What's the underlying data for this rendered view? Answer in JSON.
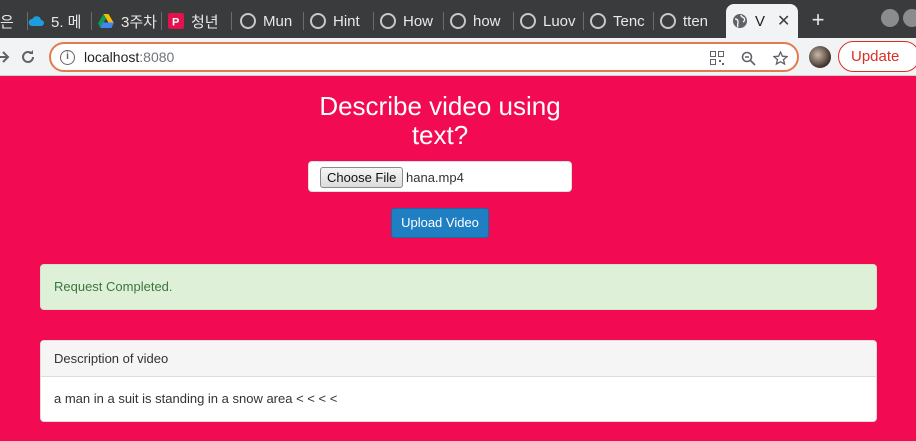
{
  "browser": {
    "tabs": [
      {
        "label": "은",
        "icon": "generic-icon"
      },
      {
        "label": "5. 메",
        "icon": "cloud-icon"
      },
      {
        "label": "3주차",
        "icon": "drive-icon"
      },
      {
        "label": "청년",
        "icon": "p-logo-icon"
      },
      {
        "label": "Mun",
        "icon": "github-icon"
      },
      {
        "label": "Hint",
        "icon": "github-icon"
      },
      {
        "label": "How",
        "icon": "github-icon"
      },
      {
        "label": "how",
        "icon": "github-icon"
      },
      {
        "label": "Luov",
        "icon": "github-icon"
      },
      {
        "label": "Tenc",
        "icon": "github-icon"
      },
      {
        "label": "tten",
        "icon": "github-icon"
      },
      {
        "label": "V",
        "icon": "globe-icon",
        "active": true
      }
    ],
    "url_host": "localhost",
    "url_port": ":8080",
    "update_label": "Update"
  },
  "page": {
    "title": "Describe video using text?",
    "choose_file_label": "Choose File",
    "file_name": "hana.mp4",
    "upload_label": "Upload Video",
    "alert_text": "Request Completed.",
    "panel_heading": "Description of video",
    "panel_body": "a man in a suit is standing in a snow area < < < <"
  },
  "colors": {
    "background": "#f20a52",
    "alert_bg": "#dff0d8",
    "alert_text": "#3c763d",
    "upload_btn": "#1f7fc2"
  }
}
